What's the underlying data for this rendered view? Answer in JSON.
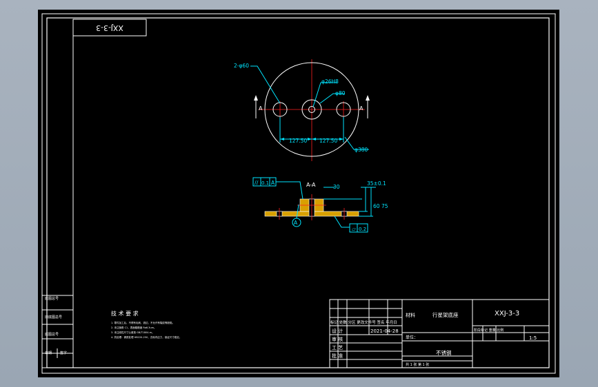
{
  "drawing": {
    "code_box_rotated": "XXJ-3-3",
    "top_view": {
      "holes_label": "2-φ60",
      "bore_label": "φ26H8",
      "boss_label": "φ80",
      "outer_label": "φ380",
      "dim_left": "127.50",
      "dim_right": "127.50",
      "section_mark_left": "A",
      "section_mark_right": "A"
    },
    "section_view": {
      "title": "A-A",
      "parallel_symbol": "//",
      "parallel_value": "0.1",
      "parallel_datum": "A",
      "flatness_symbol": "▱",
      "flatness_value": "0.2",
      "datum_label": "A",
      "dim_30": "30",
      "dim_35": "35±0.1",
      "dim_60": "60",
      "dim_75": "75"
    },
    "tech_req": {
      "title": "技 术 要 求",
      "lines": [
        "1. 零件加工后，不得有毛刺、锐边，不允许有裂纹等缺陷。",
        "2. 未注倒角 C1，表面粗糙度 Ra6.3um。",
        "3. 未注线性尺寸公差按 GB/T1804-m。",
        "4. 热处理：调质处理 HB220-250，去除内应力，保证尺寸稳定。"
      ]
    },
    "left_strip": [
      "底图总号",
      "旧底图总号",
      "底图总号",
      "日期",
      "签字"
    ],
    "title_block": {
      "part_name": "行星架底座",
      "part_code": "XXJ-3-3",
      "material_label": "材料",
      "material": "不锈钢",
      "date": "2021-04-28",
      "design_label": "设 计",
      "check_label": "审 核",
      "process_label": "工 艺",
      "approve_label": "批 准",
      "scale": "1:5",
      "sheet": "共 1 张 第 1 张",
      "header_row": "标记 处数 分区 更改文件号 签名 年月日",
      "unit_label": "单位：",
      "stage_label": "阶段标记 重量 比例"
    }
  }
}
